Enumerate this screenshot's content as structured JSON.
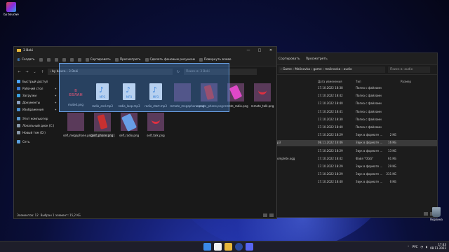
{
  "desktop": {
    "top_icon_label": "by baucwe",
    "recycle_label": "Корзина"
  },
  "back_window": {
    "toolbar": [
      "Сортировать",
      "Просмотреть"
    ],
    "breadcrumb": "› Game › Malinovka › game › malinovka › audio",
    "search_placeholder": "Поиск в: audio",
    "columns": {
      "date": "Дата изменения",
      "type": "Тип",
      "size": "Размер"
    },
    "rows": [
      {
        "name": "",
        "date": "17.10.2022 18:38",
        "type": "Папка с файлами",
        "size": ""
      },
      {
        "name": "",
        "date": "17.10.2022 18:42",
        "type": "Папка с файлами",
        "size": ""
      },
      {
        "name": "",
        "date": "17.10.2022 18:40",
        "type": "Папка с файлами",
        "size": ""
      },
      {
        "name": "",
        "date": "17.10.2022 18:41",
        "type": "Папка с файлами",
        "size": ""
      },
      {
        "name": "",
        "date": "17.10.2022 18:30",
        "type": "Папка с файлами",
        "size": ""
      },
      {
        "name": "",
        "date": "17.10.2022 18:40",
        "type": "Папка с файлами",
        "size": ""
      },
      {
        "name": "",
        "date": "17.10.2022 18:29",
        "type": "Звук в формате ...",
        "size": "2 КБ"
      },
      {
        "name": "p3",
        "date": "08.11.2022 16:46",
        "type": "Звук в формате ...",
        "size": "16 КБ"
      },
      {
        "name": "",
        "date": "17.10.2022 18:29",
        "type": "Звук в формате ...",
        "size": "13 КБ"
      },
      {
        "name": "omplete.ogg",
        "date": "17.10.2022 18:42",
        "type": "Файл \"OGG\"",
        "size": "61 КБ"
      },
      {
        "name": "",
        "date": "17.10.2022 18:29",
        "type": "Звук в формате ...",
        "size": "29 КБ"
      },
      {
        "name": "",
        "date": "17.10.2022 18:29",
        "type": "Звук в формате ...",
        "size": "231 КБ"
      },
      {
        "name": "",
        "date": "17.10.2022 18:40",
        "type": "Звук в формате ...",
        "size": "6 КБ"
      }
    ]
  },
  "window": {
    "title": "3 Beki",
    "controls": {
      "minimize": "—",
      "maximize": "□",
      "close": "✕"
    },
    "toolbar": {
      "create": "Создать",
      "sort": "Сортировать",
      "view": "Просмотреть",
      "wallpaper": "Сделать фоновым рисунком",
      "rotate_left": "Повернуть влево"
    },
    "breadcrumb": "› by baxca › 3 Beki",
    "search_placeholder": "Поиск в: 3 Beki",
    "sidebar": [
      {
        "label": "Быстрый доступ",
        "color": "#4aa3ff",
        "pin": false
      },
      {
        "label": "Рабочий стол",
        "color": "#3a7bd5",
        "pin": true
      },
      {
        "label": "Загрузки",
        "color": "#3aa0e0",
        "pin": true
      },
      {
        "label": "Документы",
        "color": "#8aa0c0",
        "pin": true
      },
      {
        "label": "Изображения",
        "color": "#4a90d0",
        "pin": true
      },
      {
        "label": "Этот компьютер",
        "color": "#5a9ad0",
        "pin": false
      },
      {
        "label": "Локальный диск (C:)",
        "color": "#8899aa",
        "pin": false
      },
      {
        "label": "Новый том (D:)",
        "color": "#8899aa",
        "pin": false
      },
      {
        "label": "Сеть",
        "color": "#5aa0e0",
        "pin": false
      }
    ],
    "files": [
      {
        "label": "muted.png",
        "kind": "text",
        "text": "В ЕБЛАН"
      },
      {
        "label": "radio_end.mp3",
        "kind": "mp3",
        "text": "MP3"
      },
      {
        "label": "radio_loop.mp3",
        "kind": "mp3",
        "text": "MP3"
      },
      {
        "label": "radio_start.mp3",
        "kind": "mp3",
        "text": "MP3"
      },
      {
        "label": "remote_megaphone.png",
        "kind": "megaphone",
        "text": ""
      },
      {
        "label": "remote_phone.png",
        "kind": "phone",
        "text": ""
      },
      {
        "label": "remote_radio.png",
        "kind": "radio",
        "text": ""
      },
      {
        "label": "remote_talk.png",
        "kind": "smile",
        "text": ""
      },
      {
        "label": "self_megaphone.png",
        "kind": "megaphone",
        "text": ""
      },
      {
        "label": "self_phone.png",
        "kind": "phone",
        "text": ""
      },
      {
        "label": "self_radio.png",
        "kind": "blueradio",
        "text": ""
      },
      {
        "label": "self_talk.png",
        "kind": "smile",
        "text": ""
      }
    ],
    "status": {
      "count": "Элементов: 12",
      "selected": "Выбран 1 элемент: 15,2 КБ"
    }
  },
  "taskbar": {
    "icons": [
      {
        "name": "start",
        "color": "#3a8ae8"
      },
      {
        "name": "yandex",
        "color": "#f0f0f0"
      },
      {
        "name": "explorer",
        "color": "#e8b73a"
      },
      {
        "name": "app",
        "color": "#2a4aa0"
      },
      {
        "name": "discord",
        "color": "#5865f2"
      }
    ],
    "lang": "РУС",
    "time": "17:43",
    "date": "08.11.2022"
  }
}
